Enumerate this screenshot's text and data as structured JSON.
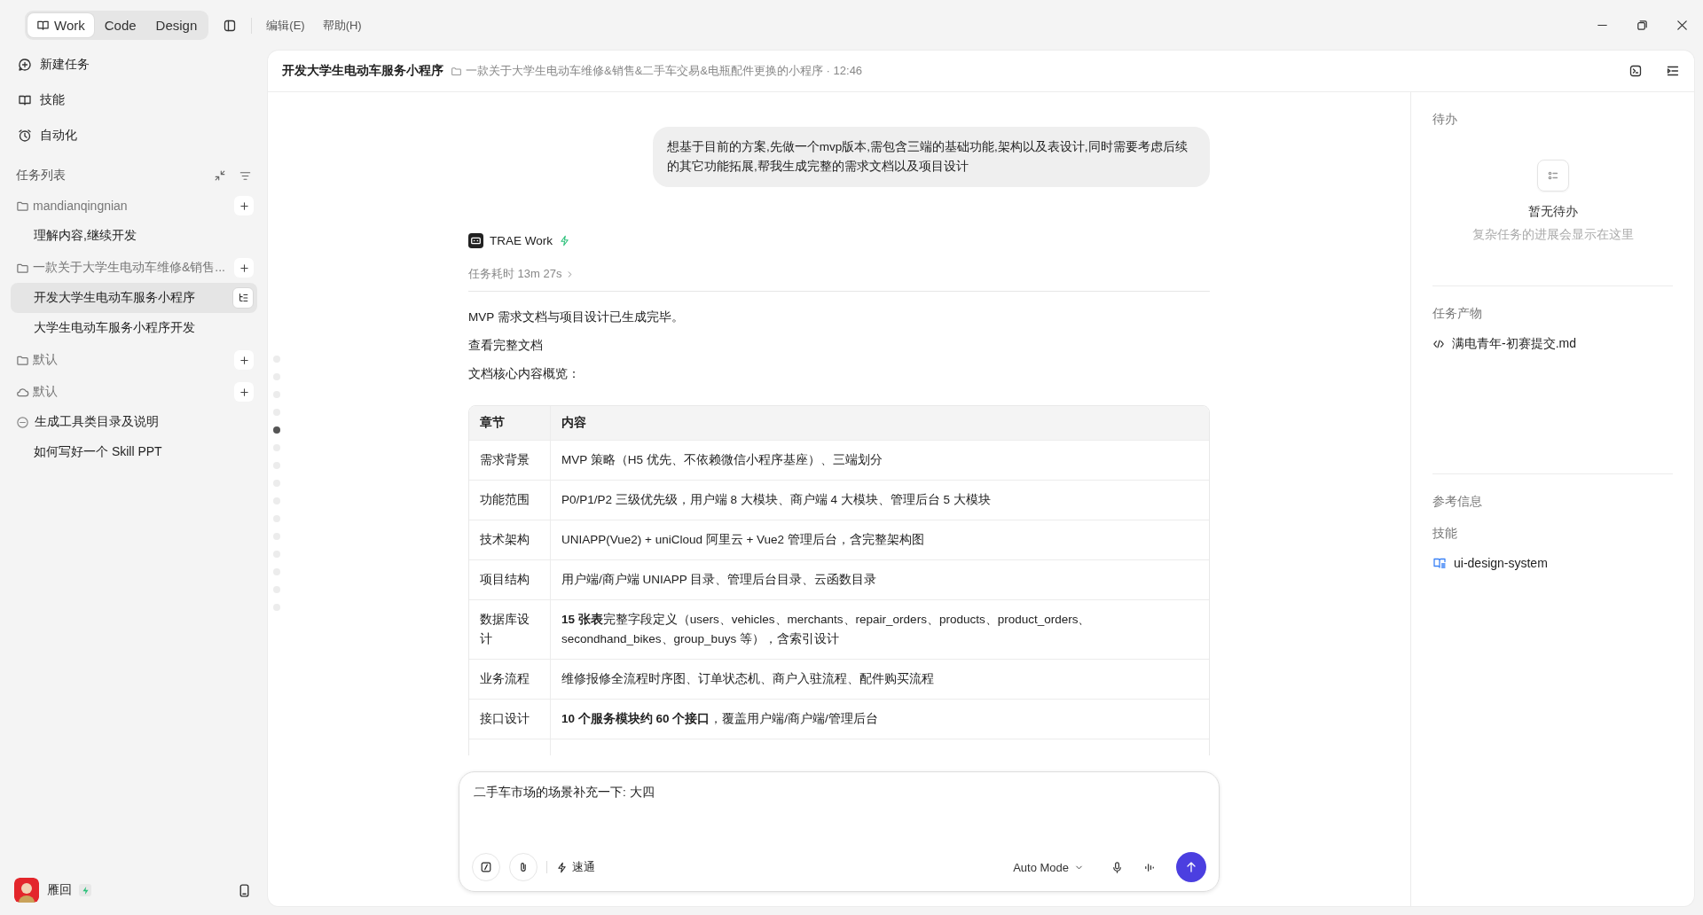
{
  "top_bar": {
    "modes": [
      {
        "label": "Work",
        "selected": true
      },
      {
        "label": "Code",
        "selected": false
      },
      {
        "label": "Design",
        "selected": false
      }
    ],
    "menus": [
      "编辑(E)",
      "帮助(H)"
    ]
  },
  "sidebar": {
    "nav": [
      {
        "kind": "new",
        "label": "新建任务"
      },
      {
        "kind": "skills",
        "label": "技能"
      },
      {
        "kind": "automation",
        "label": "自动化"
      }
    ],
    "task_list": {
      "title": "任务列表",
      "groups": [
        {
          "kind": "folder",
          "name": "mandianqingnian",
          "children": [
            {
              "kind": "plain",
              "label": "理解内容,继续开发",
              "selected": false
            }
          ]
        },
        {
          "kind": "folder",
          "name": "一款关于大学生电动车维修&销售...",
          "children": [
            {
              "kind": "plain",
              "label": "开发大学生电动车服务小程序",
              "selected": true
            },
            {
              "kind": "plain",
              "label": "大学生电动车服务小程序开发",
              "selected": false
            }
          ]
        },
        {
          "kind": "folder",
          "name": "默认"
        },
        {
          "kind": "cloud",
          "name": "默认",
          "children": [
            {
              "kind": "stopped",
              "label": "生成工具类目录及说明",
              "selected": false
            },
            {
              "kind": "plain",
              "label": "如何写好一个 Skill PPT",
              "selected": false
            }
          ]
        }
      ]
    },
    "user": {
      "name": "雁回"
    }
  },
  "header": {
    "title": "开发大学生电动车服务小程序",
    "project": "一款关于大学生电动车维修&销售&二手车交易&电瓶配件更换的小程序 · 12:46"
  },
  "outline": [
    {
      "selected": false
    },
    {
      "selected": false
    },
    {
      "selected": false
    },
    {
      "selected": false
    },
    {
      "selected": true
    },
    {
      "selected": false
    },
    {
      "selected": false
    },
    {
      "selected": false
    },
    {
      "selected": false
    },
    {
      "selected": false
    },
    {
      "selected": false
    },
    {
      "selected": false
    },
    {
      "selected": false
    },
    {
      "selected": false
    },
    {
      "selected": false
    }
  ],
  "chat": {
    "user_message": "想基于目前的方案,先做一个mvp版本,需包含三端的基础功能,架构以及表设计,同时需要考虑后续的其它功能拓展,帮我生成完整的需求文档以及项目设计",
    "assistant": {
      "name": "TRAE Work",
      "duration": "任务耗时 13m 27s",
      "paragraphs": [
        "MVP 需求文档与项目设计已生成完毕。",
        "查看完整文档",
        "文档核心内容概览："
      ],
      "table": {
        "columns": [
          "章节",
          "内容"
        ],
        "rows": [
          {
            "section": "需求背景",
            "content": "MVP 策略（H5 优先、不依赖微信小程序基座）、三端划分"
          },
          {
            "section": "功能范围",
            "content": "P0/P1/P2 三级优先级，用户端 8 大模块、商户端 4 大模块、管理后台 5 大模块"
          },
          {
            "section": "技术架构",
            "content": "UNIAPP(Vue2) + uniCloud 阿里云 + Vue2 管理后台，含完整架构图"
          },
          {
            "section": "项目结构",
            "content": "用户端/商户端 UNIAPP 目录、管理后台目录、云函数目录"
          },
          {
            "section": "数据库设计",
            "content": "**15 张表**完整字段定义（users、vehicles、merchants、repair_orders、products、product_orders、secondhand_bikes、group_buys 等），含索引设计"
          },
          {
            "section": "业务流程",
            "content": "维修报修全流程时序图、订单状态机、商户入驻流程、配件购买流程"
          },
          {
            "section": "接口设计",
            "content": "**10 个服务模块约 60 个接口**，覆盖用户端/商户端/管理后台"
          }
        ]
      }
    }
  },
  "composer": {
    "value": "二手车市场的场景补充一下: 大四",
    "speed": "速通",
    "mode": "Auto Mode"
  },
  "right_panel": {
    "todo": {
      "title": "待办",
      "empty_title": "暂无待办",
      "empty_hint": "复杂任务的进展会显示在这里"
    },
    "artifacts": {
      "title": "任务产物",
      "files": [
        "满电青年-初赛提交.md"
      ]
    },
    "references": {
      "title": "参考信息",
      "subtitle": "技能",
      "skills": [
        "ui-design-system"
      ]
    }
  }
}
